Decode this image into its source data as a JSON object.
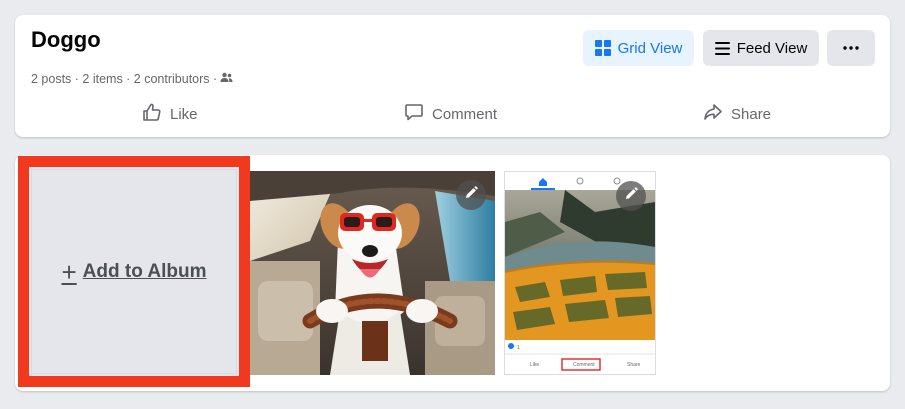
{
  "album": {
    "title": "Doggo",
    "meta": "2 posts · 2 items · 2 contributors ·"
  },
  "view_buttons": {
    "grid_label": "Grid View",
    "feed_label": "Feed View"
  },
  "actions": {
    "like_label": "Like",
    "comment_label": "Comment",
    "share_label": "Share"
  },
  "gallery": {
    "add_label": "Add to Album"
  },
  "post_thumbnail": {
    "like_label": "Like",
    "comment_label": "Comment",
    "share_label": "Share",
    "reaction_count": "1"
  },
  "colors": {
    "accent": "#1877f2",
    "highlight": "#f0391f",
    "page_bg": "#e9ebee"
  },
  "icons": {
    "contributors": "people-icon",
    "grid": "grid-icon",
    "feed": "list-icon",
    "more": "more-dots-icon",
    "like": "thumbs-up-icon",
    "comment": "comment-icon",
    "share": "share-icon",
    "edit": "pencil-icon"
  }
}
